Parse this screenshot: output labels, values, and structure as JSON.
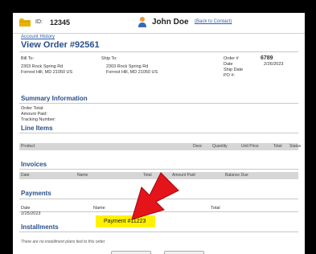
{
  "header": {
    "id_label": "ID:",
    "account_id": "12345",
    "user_name": "John Doe",
    "back_link": "(Back to Contact)"
  },
  "page": {
    "breadcrumb": "Account History",
    "title": "View Order #92561"
  },
  "bill_to": {
    "label": "Bill To:",
    "line1": "2303 Rock Spring Rd",
    "line2": "Forrest Hill, MD 21050 US"
  },
  "ship_to": {
    "label": "Ship To:",
    "line1": "2303 Rock Spring Rd",
    "line2": "Forrest Hill, MD 21050 US"
  },
  "order_info": {
    "order_label": "Order #",
    "order_value": "6789",
    "date_label": "Date",
    "date_value": "2/26/2023",
    "ship_date_label": "Ship Date",
    "po_label": "PO #:"
  },
  "summary": {
    "heading": "Summary Information",
    "order_total": "Order Total:",
    "amount_paid": "Amount Paid:",
    "tracking": "Tracking Number:"
  },
  "line_items": {
    "heading": "Line Items",
    "cols": [
      "Product",
      "Desc",
      "Quantity",
      "Unit Price",
      "Total",
      "Status"
    ]
  },
  "invoices": {
    "heading": "Invoices",
    "cols": [
      "Date",
      "Name",
      "Total",
      "Amount Paid",
      "Balance Due"
    ]
  },
  "payments": {
    "heading": "Payments",
    "cols": [
      "Date",
      "Name",
      "Total"
    ],
    "rows": [
      {
        "date": "2/25/2023",
        "name": "Payment #11223"
      }
    ]
  },
  "installments": {
    "heading": "Installments",
    "note": "There are no installment plans tied to this order"
  },
  "colors": {
    "heading": "#2a4f8a",
    "link": "#2a5db0",
    "highlight": "#fff200",
    "arrow": "#e5141a"
  }
}
